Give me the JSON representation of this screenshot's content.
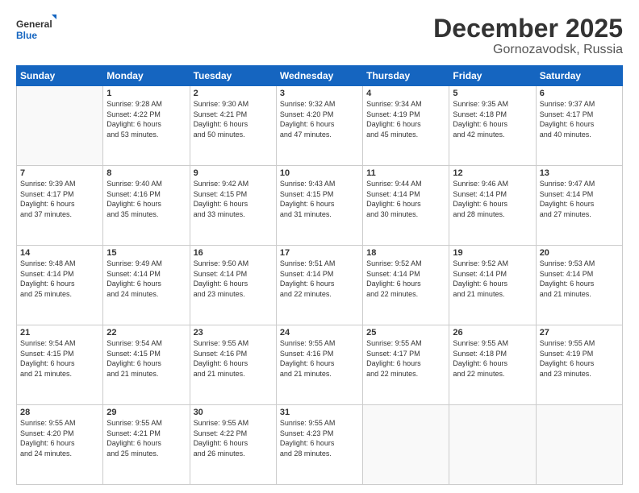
{
  "header": {
    "logo_line1": "General",
    "logo_line2": "Blue",
    "month": "December 2025",
    "location": "Gornozavodsk, Russia"
  },
  "days_of_week": [
    "Sunday",
    "Monday",
    "Tuesday",
    "Wednesday",
    "Thursday",
    "Friday",
    "Saturday"
  ],
  "weeks": [
    [
      {
        "num": "",
        "info": ""
      },
      {
        "num": "1",
        "info": "Sunrise: 9:28 AM\nSunset: 4:22 PM\nDaylight: 6 hours\nand 53 minutes."
      },
      {
        "num": "2",
        "info": "Sunrise: 9:30 AM\nSunset: 4:21 PM\nDaylight: 6 hours\nand 50 minutes."
      },
      {
        "num": "3",
        "info": "Sunrise: 9:32 AM\nSunset: 4:20 PM\nDaylight: 6 hours\nand 47 minutes."
      },
      {
        "num": "4",
        "info": "Sunrise: 9:34 AM\nSunset: 4:19 PM\nDaylight: 6 hours\nand 45 minutes."
      },
      {
        "num": "5",
        "info": "Sunrise: 9:35 AM\nSunset: 4:18 PM\nDaylight: 6 hours\nand 42 minutes."
      },
      {
        "num": "6",
        "info": "Sunrise: 9:37 AM\nSunset: 4:17 PM\nDaylight: 6 hours\nand 40 minutes."
      }
    ],
    [
      {
        "num": "7",
        "info": "Sunrise: 9:39 AM\nSunset: 4:17 PM\nDaylight: 6 hours\nand 37 minutes."
      },
      {
        "num": "8",
        "info": "Sunrise: 9:40 AM\nSunset: 4:16 PM\nDaylight: 6 hours\nand 35 minutes."
      },
      {
        "num": "9",
        "info": "Sunrise: 9:42 AM\nSunset: 4:15 PM\nDaylight: 6 hours\nand 33 minutes."
      },
      {
        "num": "10",
        "info": "Sunrise: 9:43 AM\nSunset: 4:15 PM\nDaylight: 6 hours\nand 31 minutes."
      },
      {
        "num": "11",
        "info": "Sunrise: 9:44 AM\nSunset: 4:14 PM\nDaylight: 6 hours\nand 30 minutes."
      },
      {
        "num": "12",
        "info": "Sunrise: 9:46 AM\nSunset: 4:14 PM\nDaylight: 6 hours\nand 28 minutes."
      },
      {
        "num": "13",
        "info": "Sunrise: 9:47 AM\nSunset: 4:14 PM\nDaylight: 6 hours\nand 27 minutes."
      }
    ],
    [
      {
        "num": "14",
        "info": "Sunrise: 9:48 AM\nSunset: 4:14 PM\nDaylight: 6 hours\nand 25 minutes."
      },
      {
        "num": "15",
        "info": "Sunrise: 9:49 AM\nSunset: 4:14 PM\nDaylight: 6 hours\nand 24 minutes."
      },
      {
        "num": "16",
        "info": "Sunrise: 9:50 AM\nSunset: 4:14 PM\nDaylight: 6 hours\nand 23 minutes."
      },
      {
        "num": "17",
        "info": "Sunrise: 9:51 AM\nSunset: 4:14 PM\nDaylight: 6 hours\nand 22 minutes."
      },
      {
        "num": "18",
        "info": "Sunrise: 9:52 AM\nSunset: 4:14 PM\nDaylight: 6 hours\nand 22 minutes."
      },
      {
        "num": "19",
        "info": "Sunrise: 9:52 AM\nSunset: 4:14 PM\nDaylight: 6 hours\nand 21 minutes."
      },
      {
        "num": "20",
        "info": "Sunrise: 9:53 AM\nSunset: 4:14 PM\nDaylight: 6 hours\nand 21 minutes."
      }
    ],
    [
      {
        "num": "21",
        "info": "Sunrise: 9:54 AM\nSunset: 4:15 PM\nDaylight: 6 hours\nand 21 minutes."
      },
      {
        "num": "22",
        "info": "Sunrise: 9:54 AM\nSunset: 4:15 PM\nDaylight: 6 hours\nand 21 minutes."
      },
      {
        "num": "23",
        "info": "Sunrise: 9:55 AM\nSunset: 4:16 PM\nDaylight: 6 hours\nand 21 minutes."
      },
      {
        "num": "24",
        "info": "Sunrise: 9:55 AM\nSunset: 4:16 PM\nDaylight: 6 hours\nand 21 minutes."
      },
      {
        "num": "25",
        "info": "Sunrise: 9:55 AM\nSunset: 4:17 PM\nDaylight: 6 hours\nand 22 minutes."
      },
      {
        "num": "26",
        "info": "Sunrise: 9:55 AM\nSunset: 4:18 PM\nDaylight: 6 hours\nand 22 minutes."
      },
      {
        "num": "27",
        "info": "Sunrise: 9:55 AM\nSunset: 4:19 PM\nDaylight: 6 hours\nand 23 minutes."
      }
    ],
    [
      {
        "num": "28",
        "info": "Sunrise: 9:55 AM\nSunset: 4:20 PM\nDaylight: 6 hours\nand 24 minutes."
      },
      {
        "num": "29",
        "info": "Sunrise: 9:55 AM\nSunset: 4:21 PM\nDaylight: 6 hours\nand 25 minutes."
      },
      {
        "num": "30",
        "info": "Sunrise: 9:55 AM\nSunset: 4:22 PM\nDaylight: 6 hours\nand 26 minutes."
      },
      {
        "num": "31",
        "info": "Sunrise: 9:55 AM\nSunset: 4:23 PM\nDaylight: 6 hours\nand 28 minutes."
      },
      {
        "num": "",
        "info": ""
      },
      {
        "num": "",
        "info": ""
      },
      {
        "num": "",
        "info": ""
      }
    ]
  ]
}
